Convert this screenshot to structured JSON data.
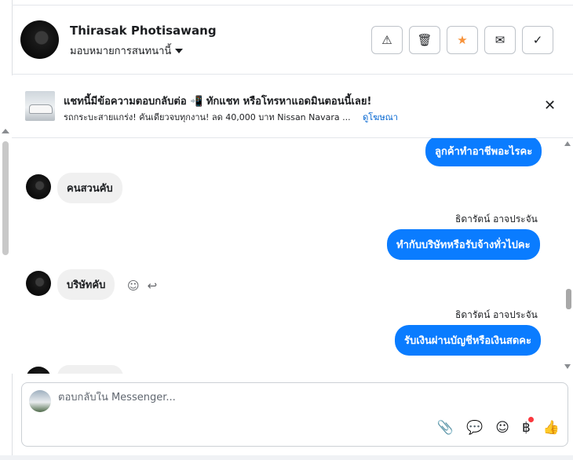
{
  "header": {
    "contact_name": "Thirasak Photisawang",
    "assign_label": "มอบหมายการสนทนานี้",
    "actions": [
      {
        "name": "warning-icon",
        "glyph": "⚠"
      },
      {
        "name": "trash-icon",
        "glyph": "🗑"
      },
      {
        "name": "star-icon",
        "glyph": "★"
      },
      {
        "name": "mark-unread-icon",
        "glyph": "✉"
      },
      {
        "name": "checkmark-icon",
        "glyph": "✓"
      }
    ]
  },
  "ad": {
    "title": "แชทนี้มีข้อความตอบกลับต่อ 📲 ทักแชท หรือโทรหาแอดมินตอนนี้เลย!",
    "subtitle": "รถกระบะสายแกร่ง! คันเดียวจบทุกงาน! ลด 40,000 บาท Nissan Navara ...",
    "link": "ดูโฆษณา",
    "close_glyph": "✕"
  },
  "messages": [
    {
      "id": "m1",
      "dir": "out",
      "text": "ลูกค้าทำอาชีพอะไรคะ"
    },
    {
      "id": "m2",
      "dir": "in",
      "text": "คนสวนคับ"
    },
    {
      "id": "m3",
      "dir": "out",
      "sender": "ธิดารัตน์ อาจประจัน",
      "text": "ทำกับบริษัทหรือรับจ้างทั่วไปคะ"
    },
    {
      "id": "m4",
      "dir": "in",
      "text": "บริษัทคับ"
    },
    {
      "id": "m5",
      "dir": "out",
      "sender": "ธิดารัตน์ อาจประจัน",
      "text": "รับเงินผ่านบัญชีหรือเงินสดคะ"
    }
  ],
  "composer": {
    "placeholder": "ตอบกลับใน Messenger...",
    "tools": [
      {
        "name": "attachment-icon",
        "glyph": "📎"
      },
      {
        "name": "saved-reply-icon",
        "glyph": "💬"
      },
      {
        "name": "emoji-icon",
        "glyph": "☺"
      },
      {
        "name": "baht-payment-icon",
        "glyph": "฿"
      },
      {
        "name": "like-icon",
        "glyph": "👍"
      }
    ]
  },
  "colors": {
    "accent": "#0a7cff",
    "star": "#f7923a",
    "link": "#0064d1",
    "notification_dot": "#fa383e"
  }
}
